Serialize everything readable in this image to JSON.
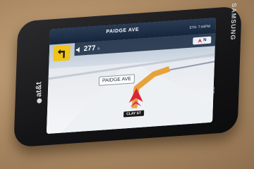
{
  "scene": {
    "colors": {
      "table": "#b08e67",
      "phone_body": "#141416",
      "route_orange": "#e8a23a",
      "position_arrow": "#d9263a",
      "turn_badge": "#f0c419",
      "hud_blue": "#1b2d45"
    }
  },
  "phone": {
    "carrier": "at&t",
    "brand": "SAMSUNG",
    "windows_logo_icon": "windows-logo-icon"
  },
  "navigation": {
    "street_name": "PAIDGE AVE",
    "eta": "ETA: 7:44PM",
    "distance": "277",
    "distance_unit": "ft",
    "compass_heading": "N",
    "map_street_label": "PAIDGE AVE",
    "current_street": "CLAY ST",
    "turn_icon": "turn-left-arrow-icon",
    "sound_icon": "speaker-icon"
  }
}
